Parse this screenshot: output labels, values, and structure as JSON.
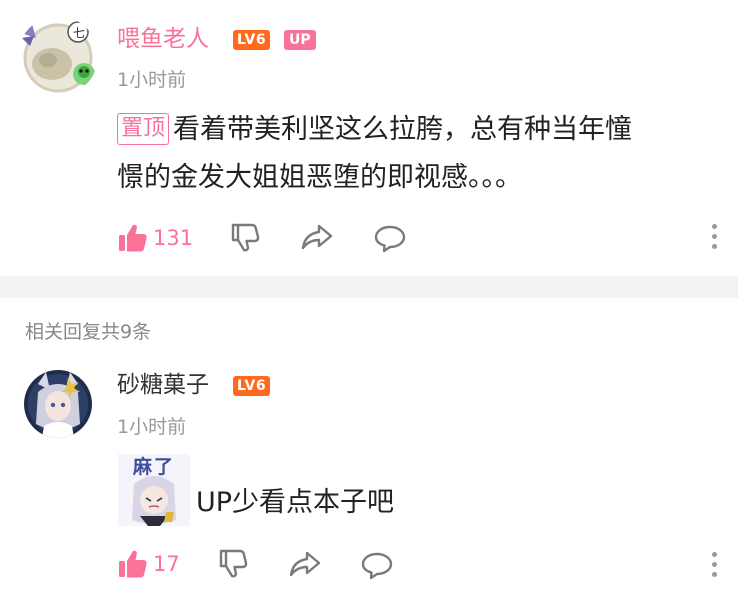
{
  "main_comment": {
    "username": "喂鱼老人",
    "level": "LV6",
    "up_badge": "UP",
    "time": "1小时前",
    "pin_label": "置顶",
    "text_line1": "看着带美利坚这么拉胯，总有种当年憧",
    "text_line2": "憬的金发大姐姐恶堕的即视感。。。",
    "like_count": "131",
    "icons": [
      "like-filled-icon",
      "dislike-icon",
      "share-icon",
      "comment-icon",
      "more-vertical-icon"
    ]
  },
  "replies": {
    "header": "相关回复共9条",
    "items": [
      {
        "username": "砂糖菓子",
        "level": "LV6",
        "time": "1小时前",
        "sticker_text": "麻了",
        "text": "UP少看点本子吧",
        "like_count": "17"
      }
    ]
  },
  "colors": {
    "brand_pink": "#fb7299",
    "level_orange": "#ff6a1f",
    "separator_gray": "#f2f3f5",
    "secondary_text": "#999999"
  }
}
